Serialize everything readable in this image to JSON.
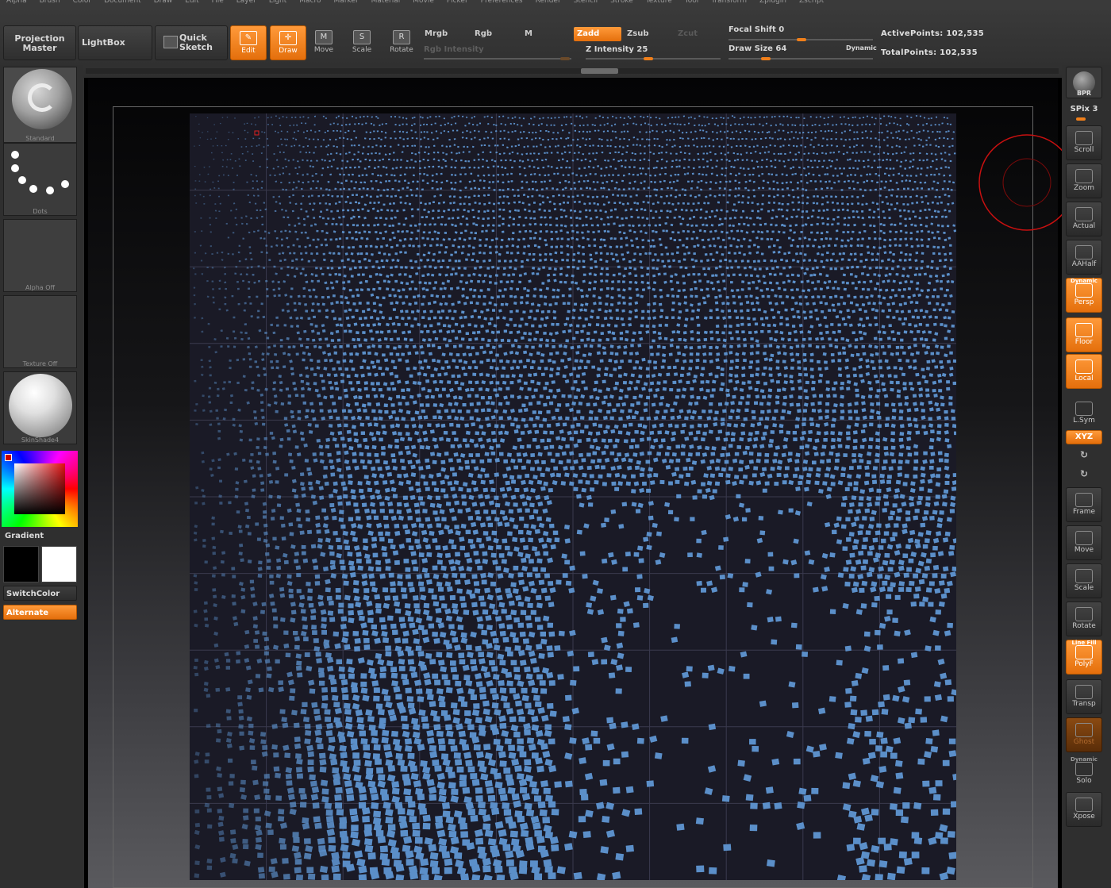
{
  "menu": [
    "Alpha",
    "Brush",
    "Color",
    "Document",
    "Draw",
    "Edit",
    "File",
    "Layer",
    "Light",
    "Macro",
    "Marker",
    "Material",
    "Movie",
    "Picker",
    "Preferences",
    "Render",
    "Stencil",
    "Stroke",
    "Texture",
    "Tool",
    "Transform",
    "Zplugin",
    "Zscript"
  ],
  "shelf": {
    "projection_master": "Projection Master",
    "lightbox": "LightBox",
    "quick_sketch": "Quick Sketch",
    "tools": [
      {
        "label": "Edit",
        "glyph": "✎",
        "active": true
      },
      {
        "label": "Draw",
        "glyph": "✛",
        "active": true
      },
      {
        "label": "Move",
        "glyph": "M",
        "active": false
      },
      {
        "label": "Scale",
        "glyph": "S",
        "active": false
      },
      {
        "label": "Rotate",
        "glyph": "R",
        "active": false
      }
    ],
    "mrgb": "Mrgb",
    "rgb": "Rgb",
    "m": "M",
    "zadd": "Zadd",
    "zsub": "Zsub",
    "zcut": "Zcut",
    "rgb_intensity": "Rgb  Intensity",
    "z_intensity": "Z  Intensity 25",
    "focal_shift": "Focal  Shift 0",
    "draw_size": "Draw  Size 64",
    "dynamic": "Dynamic",
    "active_points": "ActivePoints: 102,535",
    "total_points": "TotalPoints: 102,535"
  },
  "left": {
    "brush_caption": "Standard",
    "stroke_caption": "Dots",
    "alpha_caption": "Alpha  Off",
    "texture_caption": "Texture  Off",
    "material_caption": "SkinShade4",
    "gradient": "Gradient",
    "switch_color": "SwitchColor",
    "alternate": "Alternate"
  },
  "right": {
    "bpr": "BPR",
    "spix": "SPix 3",
    "buttons": [
      {
        "label": "Scroll",
        "icon": "hand-icon",
        "style": "normal"
      },
      {
        "label": "Zoom",
        "icon": "magnifier-icon",
        "style": "normal"
      },
      {
        "label": "Actual",
        "icon": "magnifier-icon",
        "style": "normal"
      },
      {
        "label": "AAHalf",
        "icon": "magnifier-icon",
        "style": "normal"
      },
      {
        "label": "Persp",
        "icon": "perspective-grid-icon",
        "style": "orange",
        "top_label": "Dynamic"
      },
      {
        "label": "Floor",
        "icon": "floor-icon",
        "style": "orange"
      },
      {
        "label": "Local",
        "icon": "local-icon",
        "style": "orange"
      },
      {
        "label": "L.Sym",
        "icon": "symmetry-icon",
        "style": "flat"
      },
      {
        "label": "Frame",
        "icon": "frame-icon",
        "style": "normal"
      },
      {
        "label": "Move",
        "icon": "hand-icon",
        "style": "normal"
      },
      {
        "label": "Scale",
        "icon": "magnifier-icon",
        "style": "normal"
      },
      {
        "label": "Rotate",
        "icon": "rotate-icon",
        "style": "normal"
      },
      {
        "label": "PolyF",
        "icon": "polyframe-icon",
        "style": "orange",
        "top_label": "Line Fill"
      },
      {
        "label": "Transp",
        "icon": "transparency-icon",
        "style": "normal"
      },
      {
        "label": "Ghost",
        "icon": "ghost-icon",
        "style": "dimorange"
      },
      {
        "label": "Solo",
        "icon": "solo-icon",
        "style": "flat",
        "top_label": "Dynamic"
      },
      {
        "label": "Xpose",
        "icon": "xpose-icon",
        "style": "normal"
      }
    ],
    "xyz": "XYZ"
  },
  "colors": {
    "accent": "#f07f1a",
    "mesh_tile": "#5b8fc9",
    "brush_ring": "#c81010"
  }
}
